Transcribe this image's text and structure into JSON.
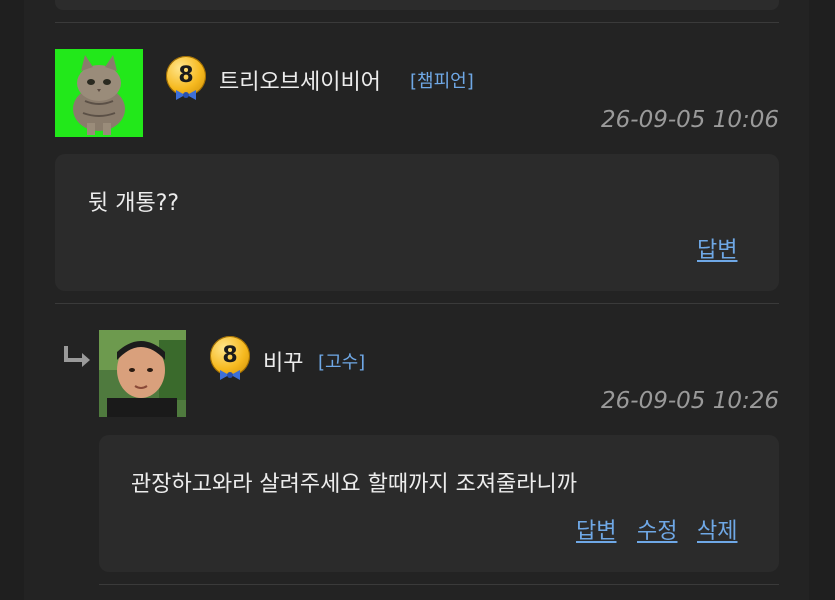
{
  "comments": [
    {
      "avatar": "cat-avatar",
      "level": "8",
      "username": "트리오브세이비어",
      "rank": "[챔피언]",
      "timestamp": "26-09-05 10:06",
      "text": "뒷 개통??",
      "actions": [
        "답변"
      ]
    },
    {
      "avatar": "man-avatar",
      "reply_icon": "reply-arrow-icon",
      "level": "8",
      "username": "비꾸",
      "rank": "[고수]",
      "timestamp": "26-09-05 10:26",
      "text": "관장하고와라 살려주세요 할때까지 조져줄라니까",
      "actions": [
        "답변",
        "수정",
        "삭제"
      ]
    }
  ],
  "colors": {
    "background": "#232323",
    "card": "#2b2b2b",
    "link": "#6fa8e6",
    "timestamp": "#9a9a9a"
  }
}
